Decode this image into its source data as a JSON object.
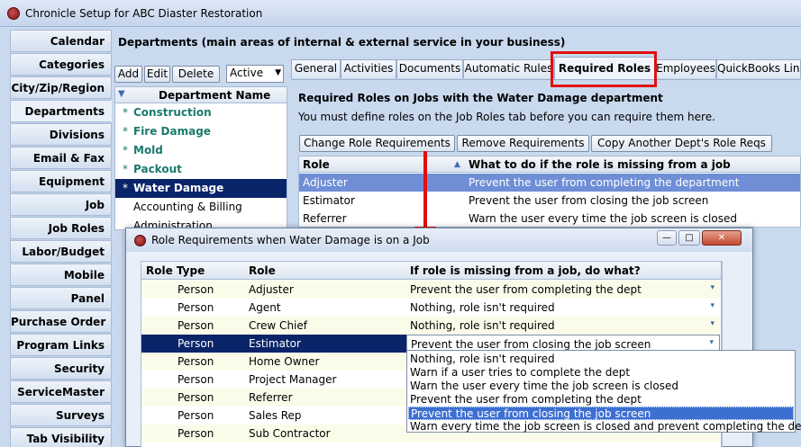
{
  "window": {
    "title": "Chronicle Setup for ABC Diaster Restoration"
  },
  "sidebar": {
    "items": [
      {
        "label": "Calendar"
      },
      {
        "label": "Categories"
      },
      {
        "label": "City/Zip/Region"
      },
      {
        "label": "Departments",
        "active": true
      },
      {
        "label": "Divisions"
      },
      {
        "label": "Email & Fax"
      },
      {
        "label": "Equipment"
      },
      {
        "label": "Job"
      },
      {
        "label": "Job Roles"
      },
      {
        "label": "Labor/Budget"
      },
      {
        "label": "Mobile"
      },
      {
        "label": "Panel"
      },
      {
        "label": "Purchase Order"
      },
      {
        "label": "Program Links"
      },
      {
        "label": "Security"
      },
      {
        "label": "ServiceMaster"
      },
      {
        "label": "Surveys"
      },
      {
        "label": "Tab Visibility"
      }
    ]
  },
  "departments": {
    "title": "Departments (main areas of internal & external service in your business)",
    "toolbar": {
      "add": "Add",
      "edit": "Edit",
      "delete": "Delete",
      "filter_value": "Active"
    },
    "list_header": "Department Name",
    "rows": [
      {
        "marker": "*",
        "name": "Construction",
        "nested": true,
        "selected": false
      },
      {
        "marker": "*",
        "name": "Fire Damage",
        "nested": true,
        "selected": false
      },
      {
        "marker": "*",
        "name": "Mold",
        "nested": true,
        "selected": false
      },
      {
        "marker": "*",
        "name": "Packout",
        "nested": true,
        "selected": false
      },
      {
        "marker": "*",
        "name": "Water Damage",
        "nested": true,
        "selected": true
      },
      {
        "marker": "",
        "name": "Accounting & Billing",
        "nested": false,
        "selected": false
      },
      {
        "marker": "",
        "name": "Administration",
        "nested": false,
        "selected": false
      }
    ]
  },
  "tabs": [
    {
      "label": "General"
    },
    {
      "label": "Activities"
    },
    {
      "label": "Documents"
    },
    {
      "label": "Automatic Rules"
    },
    {
      "label": "Required Roles",
      "active": true
    },
    {
      "label": "Employees"
    },
    {
      "label": "QuickBooks Link"
    }
  ],
  "required_roles": {
    "heading": "Required Roles on Jobs with the Water Damage department",
    "note": "You must define roles on the Job Roles tab before you can require them here.",
    "buttons": {
      "change": "Change Role Requirements",
      "remove": "Remove Requirements",
      "copy": "Copy Another Dept's Role Reqs"
    },
    "columns": {
      "role": "Role",
      "action": "What to do if the role is missing from a job"
    },
    "rows": [
      {
        "role": "Adjuster",
        "action": "Prevent the user from completing the department",
        "selected": true
      },
      {
        "role": "Estimator",
        "action": "Prevent the user from closing the job screen",
        "selected": false
      },
      {
        "role": "Referrer",
        "action": "Warn the user every time the job screen is closed",
        "selected": false
      }
    ]
  },
  "dialog": {
    "title": "Role Requirements when Water Damage is on a Job",
    "columns": {
      "type": "Role Type",
      "role": "Role",
      "action": "If role is missing from a job, do what?"
    },
    "rows": [
      {
        "type": "Person",
        "role": "Adjuster",
        "action": "Prevent the user from completing the dept"
      },
      {
        "type": "Person",
        "role": "Agent",
        "action": "Nothing, role isn't required"
      },
      {
        "type": "Person",
        "role": "Crew Chief",
        "action": "Nothing, role isn't required"
      },
      {
        "type": "Person",
        "role": "Estimator",
        "action": "Prevent the user from closing the job screen",
        "selected": true
      },
      {
        "type": "Person",
        "role": "Home Owner",
        "action": ""
      },
      {
        "type": "Person",
        "role": "Project Manager",
        "action": ""
      },
      {
        "type": "Person",
        "role": "Referrer",
        "action": ""
      },
      {
        "type": "Person",
        "role": "Sales Rep",
        "action": ""
      },
      {
        "type": "Person",
        "role": "Sub Contractor",
        "action": ""
      }
    ],
    "dropdown_options": [
      "Nothing, role isn't required",
      "Warn if a user tries to complete the dept",
      "Warn the user every time the job screen is closed",
      "Prevent the user from completing the dept",
      "Prevent the user from closing the job screen",
      "Warn every time the job screen is closed and prevent completing the dept"
    ],
    "dropdown_selected_index": 4
  },
  "colors": {
    "selection_dark": "#0a246a",
    "selection_light": "#6f8ed6",
    "dropdown_selection": "#3d6fd2",
    "highlight_red": "#e01010",
    "nested_text": "#1a7a6e"
  }
}
